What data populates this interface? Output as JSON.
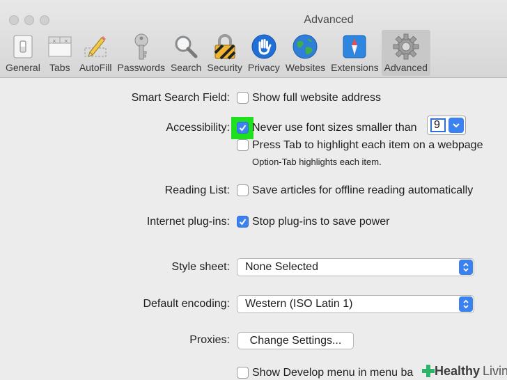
{
  "window": {
    "title": "Advanced"
  },
  "toolbar": {
    "items": [
      {
        "label": "General",
        "icon": "general-switch-icon"
      },
      {
        "label": "Tabs",
        "icon": "tabs-icon"
      },
      {
        "label": "AutoFill",
        "icon": "pencil-icon"
      },
      {
        "label": "Passwords",
        "icon": "key-icon"
      },
      {
        "label": "Search",
        "icon": "search-icon"
      },
      {
        "label": "Security",
        "icon": "lock-icon"
      },
      {
        "label": "Privacy",
        "icon": "hand-icon"
      },
      {
        "label": "Websites",
        "icon": "globe-icon"
      },
      {
        "label": "Extensions",
        "icon": "puzzle-icon"
      },
      {
        "label": "Advanced",
        "icon": "gear-icon"
      }
    ],
    "active": "Advanced"
  },
  "settings": {
    "smart_search": {
      "label": "Smart Search Field:",
      "option": "Show full website address",
      "checked": false
    },
    "accessibility": {
      "label": "Accessibility:",
      "font_option": "Never use font sizes smaller than",
      "font_checked": true,
      "font_size": "9",
      "tab_option": "Press Tab to highlight each item on a webpage",
      "tab_checked": false,
      "tab_hint": "Option-Tab highlights each item."
    },
    "reading_list": {
      "label": "Reading List:",
      "option": "Save articles for offline reading automatically",
      "checked": false
    },
    "plugins": {
      "label": "Internet plug-ins:",
      "option": "Stop plug-ins to save power",
      "checked": true
    },
    "style_sheet": {
      "label": "Style sheet:",
      "value": "None Selected"
    },
    "encoding": {
      "label": "Default encoding:",
      "value": "Western (ISO Latin 1)"
    },
    "proxies": {
      "label": "Proxies:",
      "button": "Change Settings..."
    },
    "develop": {
      "option": "Show Develop menu in menu ba",
      "checked": false
    }
  },
  "watermark": {
    "brand1": "Healthy",
    "brand2": "Living"
  },
  "colors": {
    "accent": "#3b82f0",
    "highlight": "#1fe01f"
  }
}
